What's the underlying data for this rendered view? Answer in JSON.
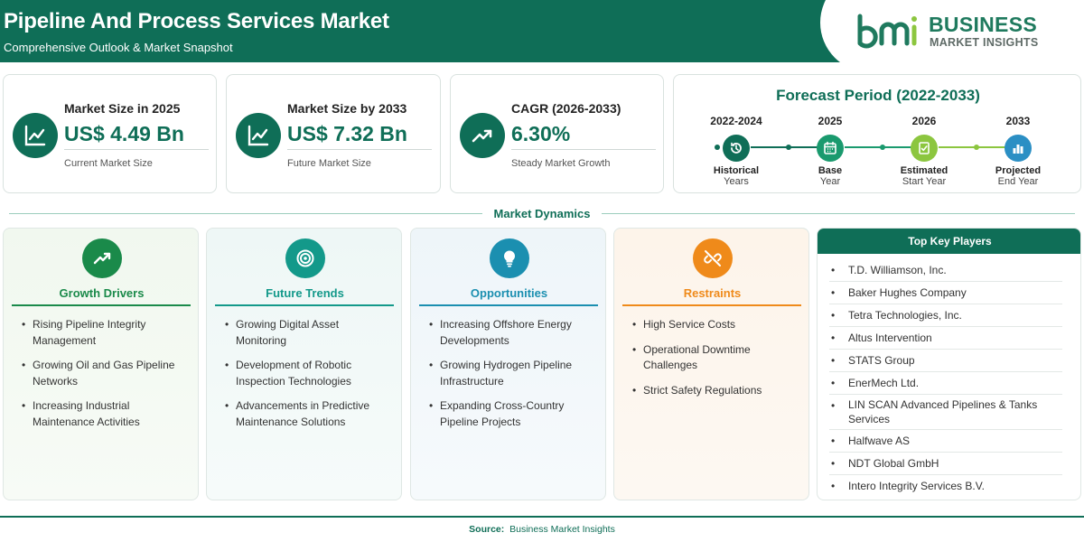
{
  "header": {
    "title": "Pipeline And Process Services Market",
    "subtitle": "Comprehensive Outlook & Market Snapshot",
    "logo_line1": "BUSINESS",
    "logo_line2": "MARKET INSIGHTS"
  },
  "stats": [
    {
      "label": "Market Size in 2025",
      "value": "US$ 4.49 Bn",
      "note": "Current Market Size",
      "icon": "line-chart-icon"
    },
    {
      "label": "Market Size by 2033",
      "value": "US$ 7.32 Bn",
      "note": "Future Market Size",
      "icon": "line-chart-icon"
    },
    {
      "label": "CAGR (2026-2033)",
      "value": "6.30%",
      "note": "Steady Market Growth",
      "icon": "trend-up-icon"
    }
  ],
  "forecast": {
    "title": "Forecast Period (2022-2033)",
    "steps": [
      {
        "year": "2022-2024",
        "line1": "Historical",
        "line2": "Years",
        "color": "#0f6e57",
        "icon": "history-icon"
      },
      {
        "year": "2025",
        "line1": "Base",
        "line2": "Year",
        "color": "#1a9a6e",
        "icon": "calendar-icon"
      },
      {
        "year": "2026",
        "line1": "Estimated",
        "line2": "Start Year",
        "color": "#8cc63f",
        "icon": "estimate-icon"
      },
      {
        "year": "2033",
        "line1": "Projected",
        "line2": "End Year",
        "color": "#2b8fc4",
        "icon": "bar-chart-icon"
      }
    ]
  },
  "dynamics": {
    "title": "Market Dynamics",
    "panels": [
      {
        "title": "Growth Drivers",
        "color": "#1a8a4a",
        "icon": "trend-up-icon",
        "items": [
          "Rising Pipeline Integrity Management",
          "Growing Oil and Gas Pipeline Networks",
          "Increasing Industrial Maintenance Activities"
        ]
      },
      {
        "title": "Future Trends",
        "color": "#13998a",
        "icon": "target-icon",
        "items": [
          "Growing Digital Asset Monitoring",
          "Development of Robotic Inspection Technologies",
          "Advancements in Predictive Maintenance Solutions"
        ]
      },
      {
        "title": "Opportunities",
        "color": "#1b8fb0",
        "icon": "lightbulb-icon",
        "items": [
          "Increasing Offshore Energy Developments",
          "Growing Hydrogen Pipeline Infrastructure",
          "Expanding Cross-Country Pipeline Projects"
        ]
      },
      {
        "title": "Restraints",
        "color": "#ef8a1a",
        "icon": "broken-link-icon",
        "items": [
          "High Service Costs",
          "Operational Downtime Challenges",
          "Strict Safety Regulations"
        ]
      }
    ]
  },
  "key_players": {
    "title": "Top Key Players",
    "items": [
      "T.D. Williamson, Inc.",
      "Baker Hughes Company",
      "Tetra Technologies, Inc.",
      "Altus Intervention",
      "STATS Group",
      "EnerMech Ltd.",
      "LIN SCAN Advanced Pipelines & Tanks Services",
      "Halfwave AS",
      "NDT Global GmbH",
      "Intero Integrity Services B.V."
    ]
  },
  "footer": {
    "label": "Source:",
    "text": "Business Market Insights"
  }
}
